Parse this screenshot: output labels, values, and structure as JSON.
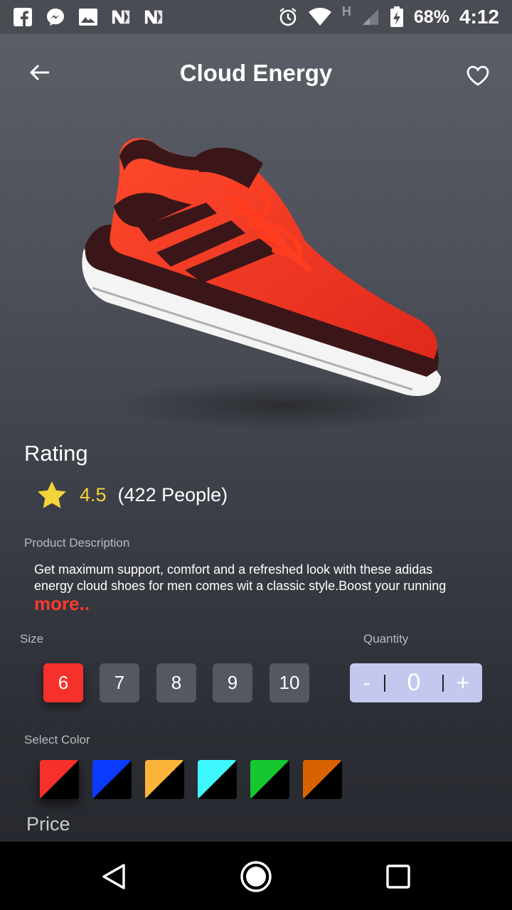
{
  "status_bar": {
    "battery": "68%",
    "time": "4:12",
    "network_label": "H"
  },
  "header": {
    "title": "Cloud Energy"
  },
  "rating": {
    "heading": "Rating",
    "value": "4.5",
    "count": "(422 People)",
    "star_color": "#f5d33a"
  },
  "description": {
    "label": "Product Description",
    "text": "Get maximum support, comfort and a refreshed look with these adidas energy cloud shoes for men comes wit a classic style.Boost your running",
    "more": "more.."
  },
  "size": {
    "label": "Size",
    "options": [
      "6",
      "7",
      "8",
      "9",
      "10"
    ],
    "selected": "6"
  },
  "quantity": {
    "label": "Quantity",
    "minus": "-",
    "value": "0",
    "plus": "+"
  },
  "color": {
    "label": "Select Color",
    "swatches": [
      "#f6302a",
      "#0a3bff",
      "#fbb33a",
      "#3ff8ff",
      "#16c830",
      "#d96200"
    ]
  },
  "price": {
    "label": "Price"
  },
  "colors": {
    "accent": "#f6302a",
    "rating": "#f5d33a",
    "stepper": "#c5c8ee"
  }
}
